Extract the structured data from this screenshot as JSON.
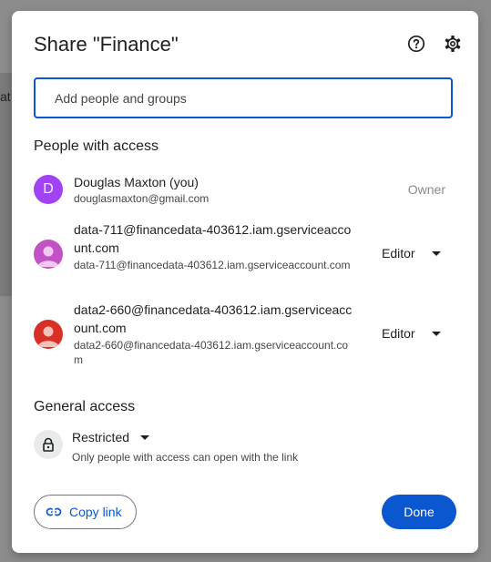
{
  "background": {
    "fragment_text": "at"
  },
  "dialog": {
    "title": "Share \"Finance\"",
    "help_icon": "help-circle-icon",
    "settings_icon": "gear-icon"
  },
  "add_people": {
    "placeholder": "Add people and groups",
    "value": ""
  },
  "people_section": {
    "title": "People with access",
    "people": [
      {
        "avatar_letter": "D",
        "avatar_color": "#a142f4",
        "name": "Douglas Maxton (you)",
        "email": "douglasmaxton@gmail.com",
        "role": "Owner"
      },
      {
        "avatar_color": "#c251c5",
        "name": "data-711@financedata-403612.iam.gserviceaccount.com",
        "email": "data-711@financedata-403612.iam.gserviceaccount.com",
        "role": "Editor"
      },
      {
        "avatar_color": "#d93025",
        "name": "data2-660@financedata-403612.iam.gserviceaccount.com",
        "email": "data2-660@financedata-403612.iam.gserviceaccount.com",
        "role": "Editor"
      }
    ]
  },
  "general_access": {
    "title": "General access",
    "lock_icon": "lock-icon",
    "level": "Restricted",
    "description": "Only people with access can open with the link"
  },
  "footer": {
    "copy_link_label": "Copy link",
    "copy_link_icon": "link-icon",
    "done_label": "Done"
  },
  "colors": {
    "accent": "#0b57d0",
    "owner_text": "#8a8a8a"
  }
}
